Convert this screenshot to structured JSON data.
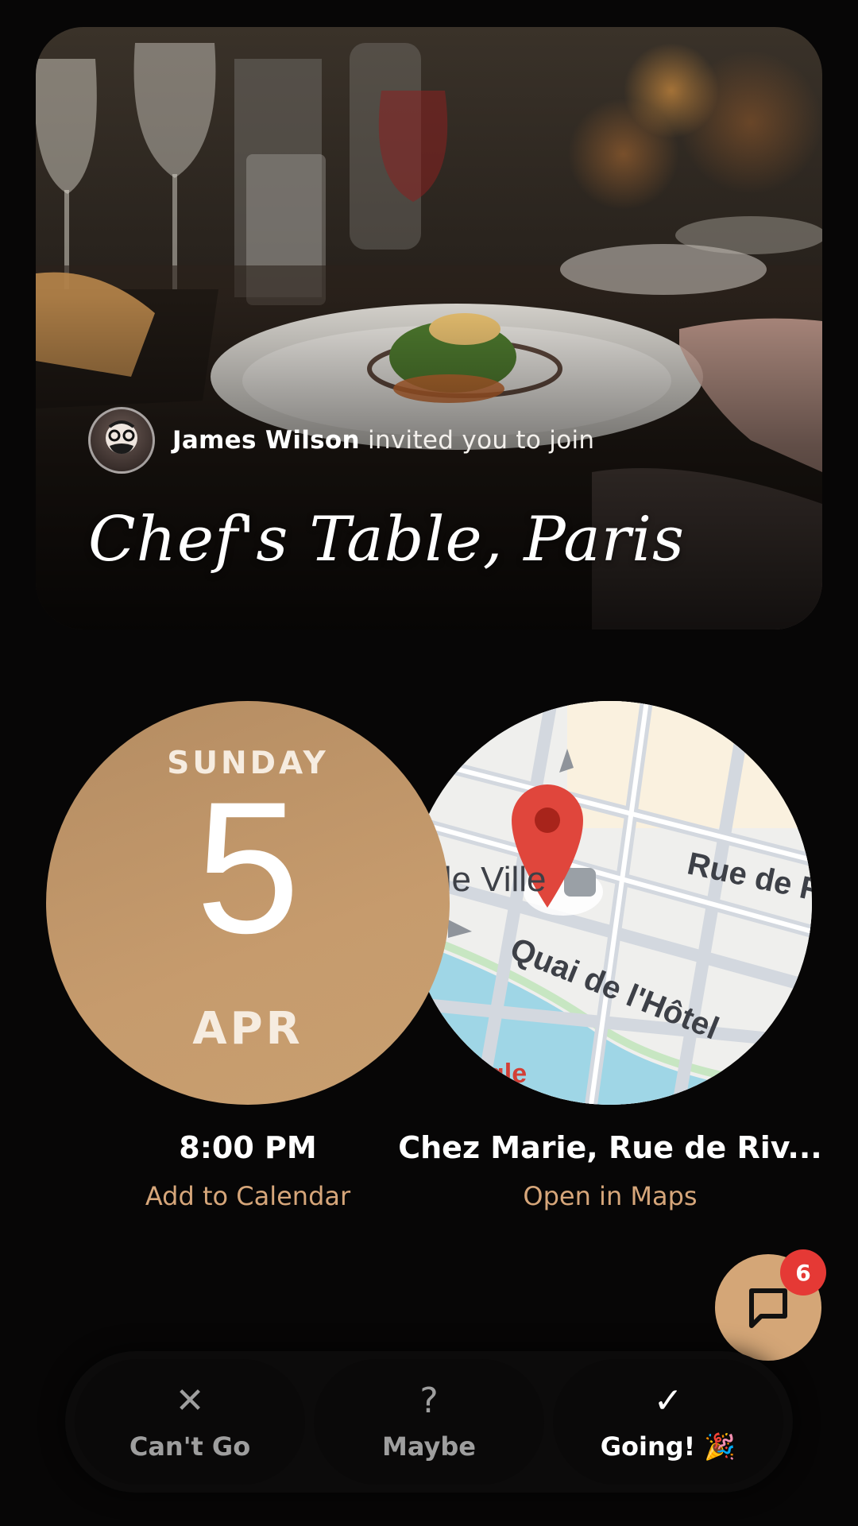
{
  "invite": {
    "host_name": "James Wilson",
    "invite_suffix": " invited you to join",
    "event_title": "Chef's Table, Paris"
  },
  "date": {
    "weekday": "SUNDAY",
    "day": "5",
    "month": "APR",
    "time": "8:00 PM",
    "calendar_link": "Add to Calendar"
  },
  "location": {
    "venue": "Chez Marie, Rue de Riv...",
    "maps_link": "Open in Maps",
    "map_labels": {
      "label_1": "de Ville",
      "label_2": "Rue de R",
      "label_3": "Quai de l'Hôtel",
      "label_4": "gle"
    }
  },
  "chat": {
    "unread_count": "6",
    "icon": "chat-bubble-icon"
  },
  "rsvp": {
    "cant_go": {
      "icon": "close-icon",
      "glyph": "✕",
      "label": "Can't Go"
    },
    "maybe": {
      "icon": "question-icon",
      "glyph": "?",
      "label": "Maybe"
    },
    "going": {
      "icon": "check-icon",
      "glyph": "✓",
      "label": "Going! 🎉"
    }
  },
  "colors": {
    "accent": "#d4a677",
    "date_circle": "#c69b6d",
    "link": "#d6a67a",
    "badge": "#e53935",
    "background": "#070606"
  }
}
